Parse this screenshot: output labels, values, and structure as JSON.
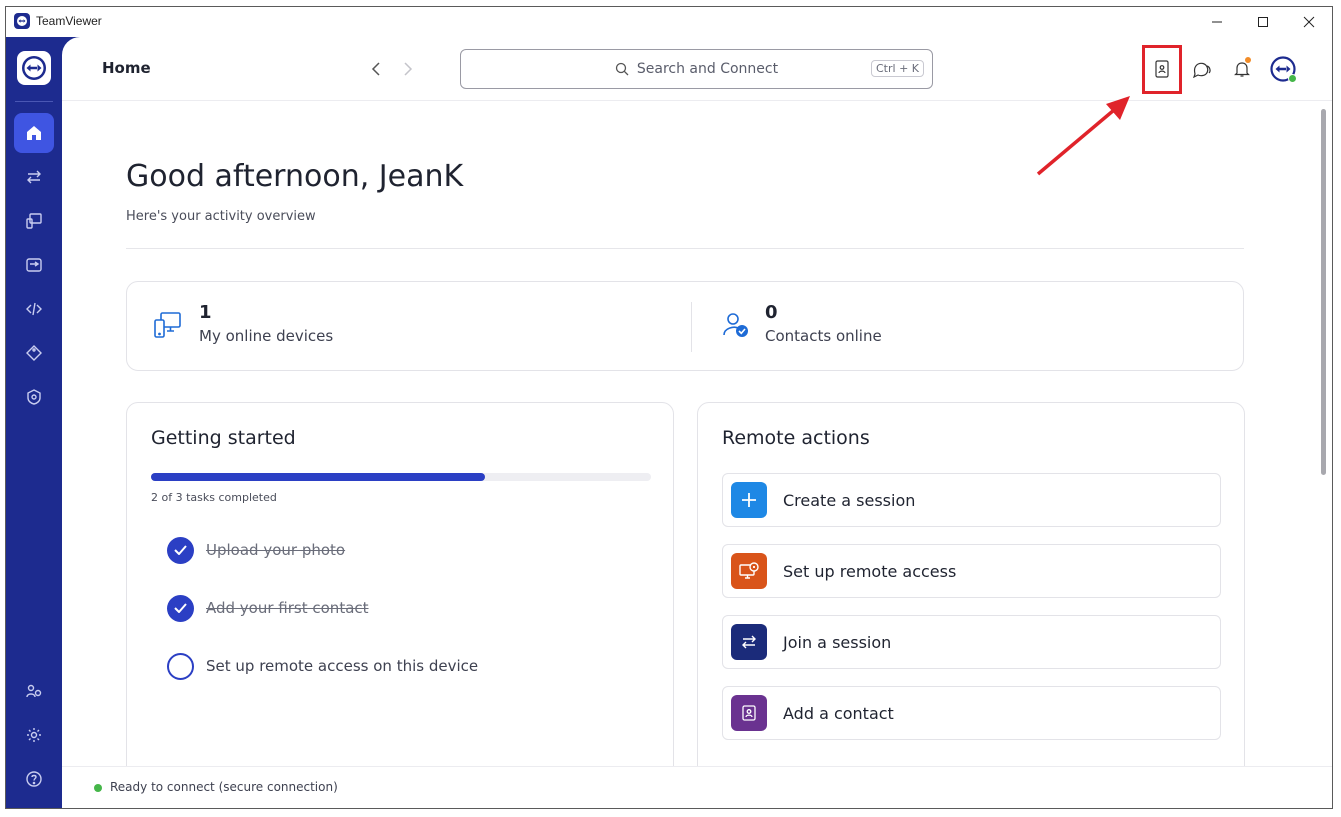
{
  "window": {
    "title": "TeamViewer"
  },
  "topbar": {
    "breadcrumb": "Home",
    "search_placeholder": "Search and Connect",
    "search_shortcut": "Ctrl + K"
  },
  "sidebar": {
    "items": [
      {
        "icon": "home-icon",
        "active": true
      },
      {
        "icon": "transfer-icon"
      },
      {
        "icon": "devices-icon"
      },
      {
        "icon": "sessions-icon"
      },
      {
        "icon": "code-icon"
      },
      {
        "icon": "tag-icon"
      },
      {
        "icon": "shield-gear-icon"
      },
      {
        "icon": "people-gear-icon"
      },
      {
        "icon": "settings-icon"
      },
      {
        "icon": "help-icon"
      }
    ]
  },
  "home": {
    "greeting": "Good afternoon, JeanK",
    "subtitle": "Here's your activity overview"
  },
  "stats": {
    "devices_count": "1",
    "devices_label": "My online devices",
    "contacts_count": "0",
    "contacts_label": "Contacts online"
  },
  "getting_started": {
    "title": "Getting started",
    "progress_fraction": 0.667,
    "progress_text": "2 of 3 tasks completed",
    "tasks": [
      {
        "label": "Upload your photo",
        "done": true
      },
      {
        "label": "Add your first contact",
        "done": true
      },
      {
        "label": "Set up remote access on this device",
        "done": false
      }
    ]
  },
  "remote_actions": {
    "title": "Remote actions",
    "items": [
      {
        "label": "Create a session",
        "color": "#1e88e5"
      },
      {
        "label": "Set up remote access",
        "color": "#d9541a"
      },
      {
        "label": "Join a session",
        "color": "#1b2b7a"
      },
      {
        "label": "Add a contact",
        "color": "#6a3290"
      }
    ]
  },
  "status": {
    "text": "Ready to connect (secure connection)"
  },
  "colors": {
    "brand": "#1d2b8f",
    "accent": "#2b3fc4",
    "annotation": "#e0232a"
  }
}
